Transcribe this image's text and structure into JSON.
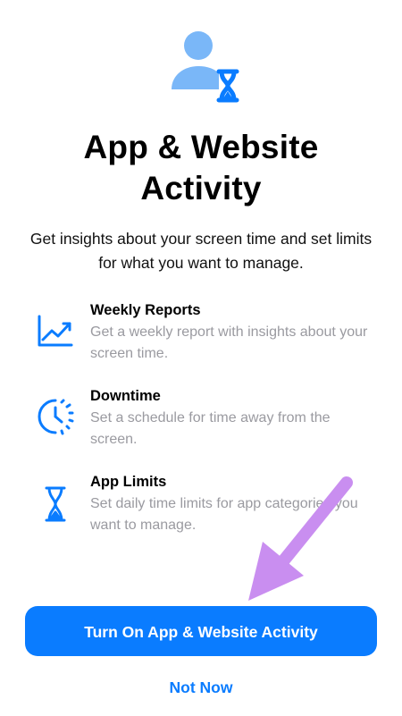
{
  "title_lines": [
    "App & Website",
    "Activity"
  ],
  "subtitle": "Get insights about your screen time and set limits for what you want to manage.",
  "features": [
    {
      "icon": "chart-line-icon",
      "title": "Weekly Reports",
      "description": "Get a weekly report with insights about your screen time."
    },
    {
      "icon": "downtime-clock-icon",
      "title": "Downtime",
      "description": "Set a schedule for time away from the screen."
    },
    {
      "icon": "hourglass-icon",
      "title": "App Limits",
      "description": "Set daily time limits for app categories you want to manage."
    }
  ],
  "primary_button": {
    "label": "Turn On App & Website Activity"
  },
  "secondary_link": {
    "label": "Not Now"
  },
  "hero_icon": "person-hourglass-icon",
  "colors": {
    "accent": "#0a7cff",
    "icon_light": "#7ab7f8",
    "annotation_arrow": "#c98ef0",
    "muted_text": "#9a9aa0"
  }
}
